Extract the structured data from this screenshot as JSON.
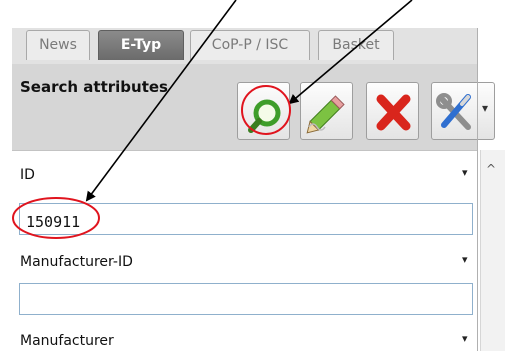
{
  "tabs": [
    {
      "label": "News",
      "active": false
    },
    {
      "label": "E-Typ",
      "active": true
    },
    {
      "label": "CoP-P / ISC",
      "active": false
    },
    {
      "label": "Basket",
      "active": false
    }
  ],
  "panel": {
    "title": "Search attributes"
  },
  "toolbar": {
    "buttons": [
      {
        "name": "search-button",
        "icon": "magnifier-icon"
      },
      {
        "name": "edit-button",
        "icon": "pencil-icon"
      },
      {
        "name": "delete-button",
        "icon": "red-x-icon"
      },
      {
        "name": "tools-button",
        "icon": "wrench-screwdriver-icon"
      }
    ],
    "dropdown_arrow": "▾"
  },
  "fields": [
    {
      "label": "ID",
      "value": "150911",
      "arrow": "▾"
    },
    {
      "label": "Manufacturer-ID",
      "value": "",
      "arrow": "▾"
    },
    {
      "label": "Manufacturer",
      "value": "",
      "arrow": "▾"
    }
  ],
  "scrollbar": {
    "up_glyph": "^"
  },
  "colors": {
    "annotation_red": "#e0141e",
    "active_tab": "#707070",
    "input_border": "#8fb0cc"
  }
}
